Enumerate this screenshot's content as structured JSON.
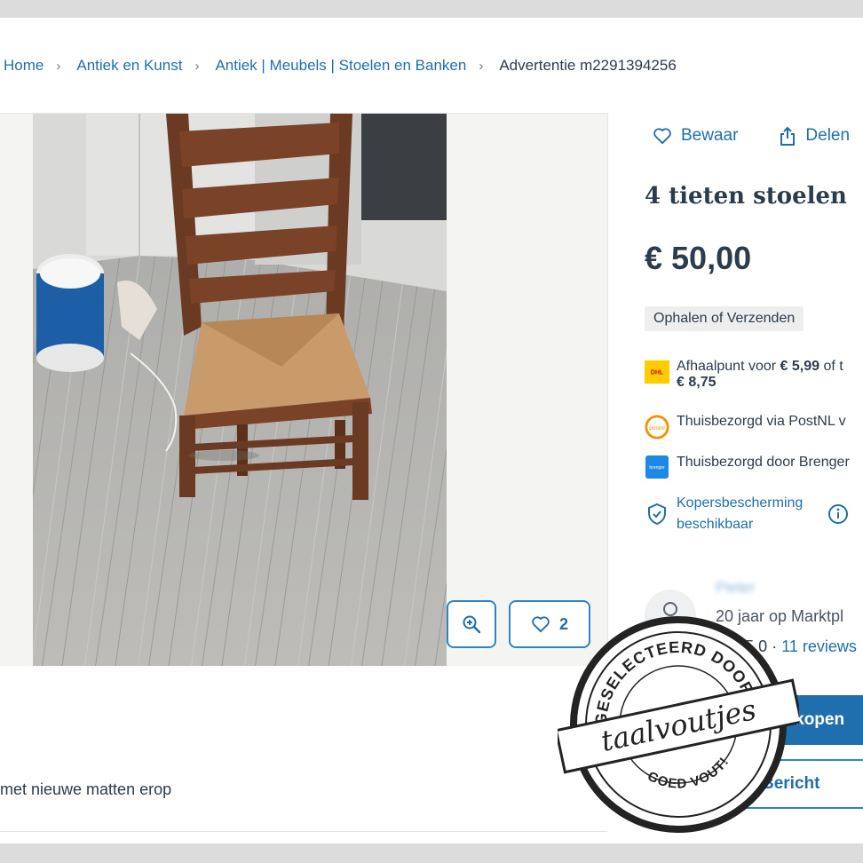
{
  "breadcrumb": {
    "items": [
      "Home",
      "Antiek en Kunst",
      "Antiek | Meubels | Stoelen en Banken"
    ],
    "current": "Advertentie m2291394256"
  },
  "gallery": {
    "favorites_count": "2"
  },
  "description": {
    "snippet": "met nieuwe matten erop"
  },
  "actions": {
    "save_label": "Bewaar",
    "share_label": "Delen"
  },
  "listing": {
    "title": "4 tieten stoelen",
    "price": "€ 50,00",
    "delivery_tag": "Ophalen of Verzenden"
  },
  "shipping": {
    "dhl_prefix": "Afhaalpunt voor",
    "dhl_price": "€ 5,99",
    "dhl_suffix": "of t",
    "dhl_price2": "€ 8,75",
    "postnl": "Thuisbezorgd via PostNL v",
    "brenger": "Thuisbezorgd door Brenger",
    "brenger_logo_text": "brenger",
    "postnl_logo_text": "postnl",
    "dhl_logo_text": "DHL",
    "protection": "Kopersbescherming beschikbaar"
  },
  "seller": {
    "name": "Pieter",
    "years": "20 jaar op Marktpl",
    "rating": "5.0",
    "reviews": "11 reviews"
  },
  "buttons": {
    "buy": "Direct kopen",
    "message": "Bericht"
  },
  "stamp": {
    "top_text": "GESELECTEERD DOOR",
    "brand": "taalvoutjes",
    "bottom_text": "GOED VOUT!"
  },
  "colors": {
    "link_blue": "#1f6fae",
    "text_dark": "#2d3c4d",
    "dhl_yellow": "#ffcc00",
    "postnl_orange": "#f39100",
    "brenger_blue": "#1e88e5"
  }
}
